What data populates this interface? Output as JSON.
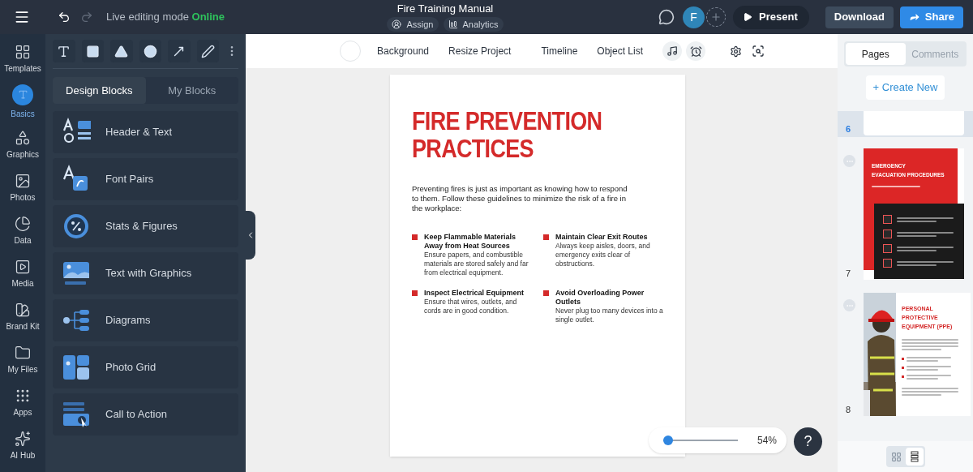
{
  "topbar": {
    "mode_label": "Live editing mode",
    "mode_status": "Online",
    "redo_disabled": true,
    "title": "Fire Training Manual",
    "title_buttons": [
      "Assign",
      "Analytics"
    ],
    "avatar": "F",
    "present": "Present",
    "download": "Download",
    "share": "Share"
  },
  "rail": [
    {
      "label": "Templates",
      "selected": false
    },
    {
      "label": "Basics",
      "selected": true
    },
    {
      "label": "Graphics",
      "selected": false
    },
    {
      "label": "Photos",
      "selected": false
    },
    {
      "label": "Data",
      "selected": false
    },
    {
      "label": "Media",
      "selected": false
    },
    {
      "label": "Brand Kit",
      "selected": false
    },
    {
      "label": "My Files",
      "selected": false
    },
    {
      "label": "Apps",
      "selected": false
    },
    {
      "label": "AI Hub",
      "selected": false
    }
  ],
  "panel": {
    "tabs": [
      {
        "label": "Design Blocks",
        "selected": true
      },
      {
        "label": "My Blocks",
        "selected": false
      }
    ],
    "blocks": [
      "Header & Text",
      "Font Pairs",
      "Stats & Figures",
      "Text with Graphics",
      "Diagrams",
      "Photo Grid",
      "Call to Action"
    ]
  },
  "canvas_toolbar": [
    "Background",
    "Resize Project",
    "Timeline",
    "Object List"
  ],
  "document": {
    "title_lines": [
      "FIRE PREVENTION",
      "PRACTICES"
    ],
    "intro": "Preventing fires is just as important as knowing how to respond to them. Follow these guidelines to minimize the risk of a fire in the workplace:",
    "items": [
      {
        "title": "Keep Flammable Materials Away from Heat Sources",
        "text": "Ensure papers, and combustible materials are stored safely and far from electrical equipment."
      },
      {
        "title": "Maintain Clear Exit Routes",
        "text": "Always keep aisles, doors, and emergency exits clear of obstructions."
      },
      {
        "title": "Inspect Electrical Equipment",
        "text": "Ensure that wires, outlets, and cords are in good condition."
      },
      {
        "title": "Avoid Overloading Power Outlets",
        "text": "Never plug too many devices into a single outlet."
      }
    ]
  },
  "zoom": {
    "level": 0.06,
    "reading": "54%"
  },
  "help": "?",
  "pages_panel": {
    "tabs": [
      {
        "label": "Pages",
        "selected": true
      },
      {
        "label": "Comments",
        "selected": false
      }
    ],
    "create": "+ Create New",
    "pages": [
      {
        "number": "6",
        "kind": "blank",
        "selected": true
      },
      {
        "number": "7",
        "kind": "evacuation",
        "selected": false,
        "title_lines": [
          "EMERGENCY",
          "EVACUATION PROCEDURES"
        ]
      },
      {
        "number": "8",
        "kind": "ppe",
        "selected": false,
        "title_lines": [
          "PERSONAL",
          "PROTECTIVE",
          "EQUIPMENT (PPE)"
        ]
      }
    ],
    "views": [
      {
        "kind": "grid",
        "selected": false
      },
      {
        "kind": "list",
        "selected": true
      }
    ]
  }
}
